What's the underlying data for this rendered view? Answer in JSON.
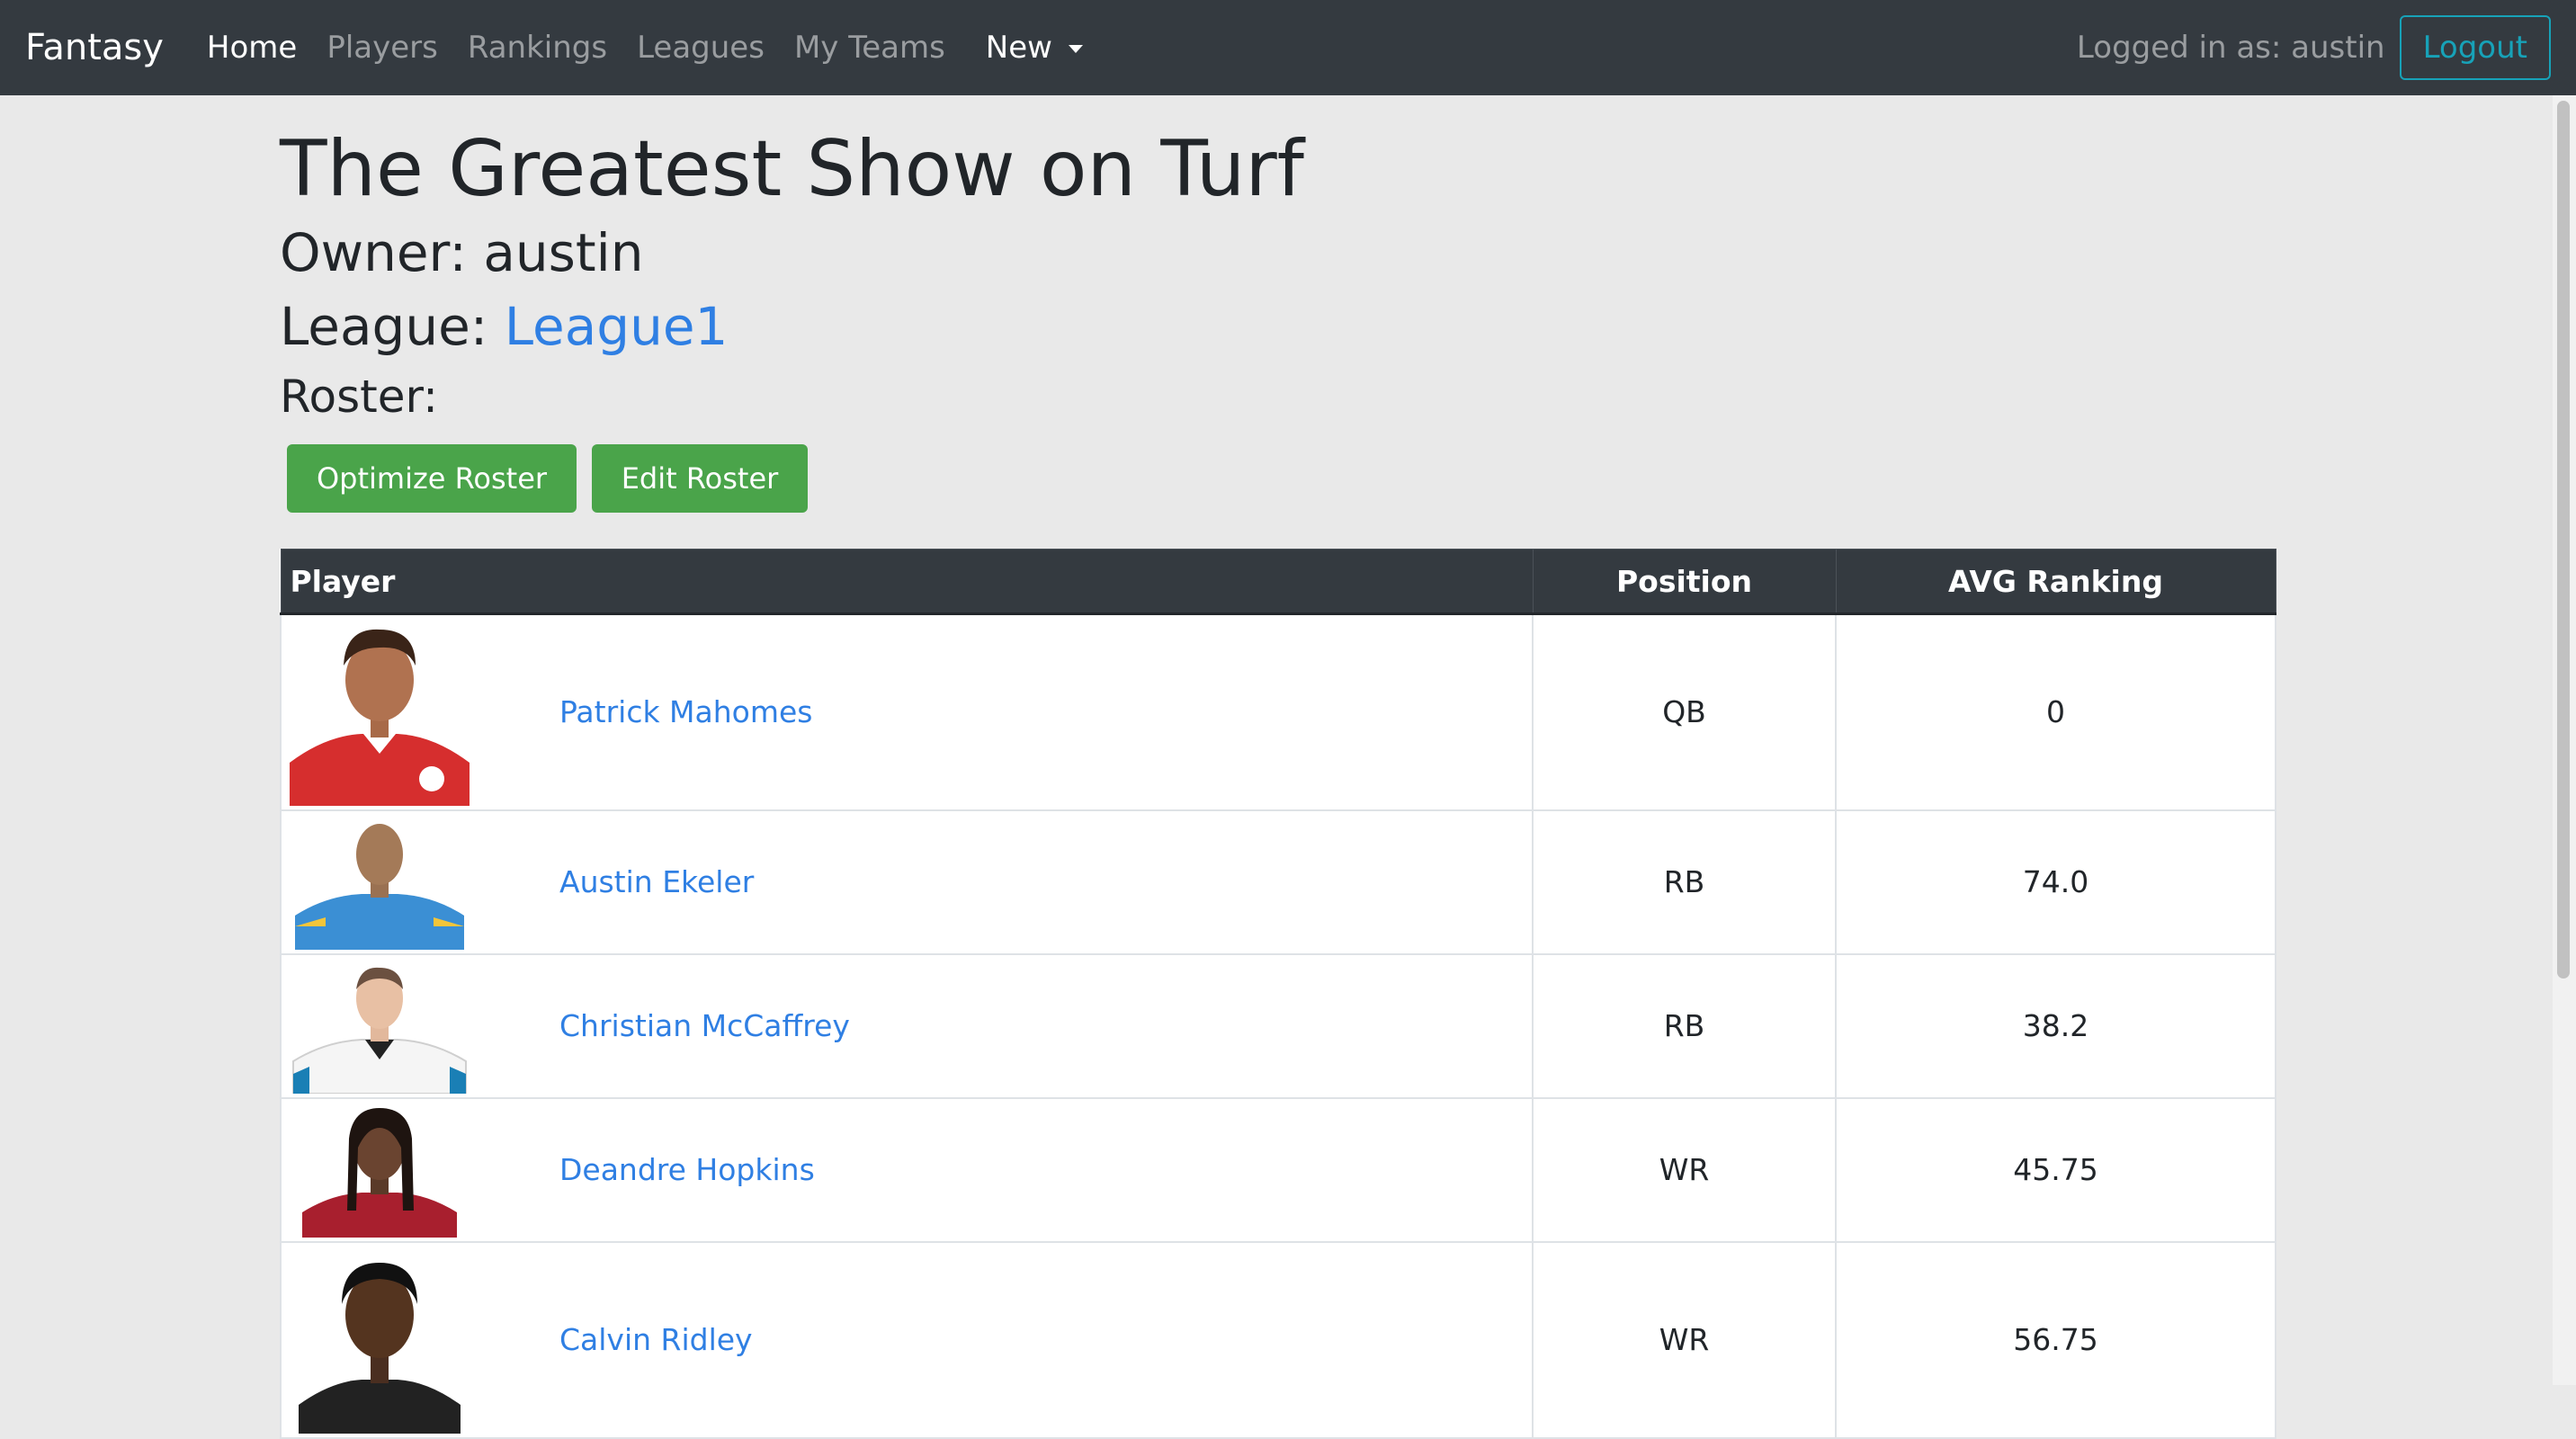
{
  "nav": {
    "brand": "Fantasy",
    "links": [
      "Home",
      "Players",
      "Rankings",
      "Leagues",
      "My Teams"
    ],
    "dropdown": "New",
    "logged_in": "Logged in as: austin",
    "logout": "Logout"
  },
  "team": {
    "title": "The Greatest Show on Turf",
    "owner_label": "Owner:",
    "owner": "austin",
    "league_label": "League:",
    "league": "League1",
    "roster_label": "Roster:"
  },
  "actions": {
    "optimize": "Optimize Roster",
    "edit": "Edit Roster"
  },
  "table": {
    "headers": [
      "Player",
      "Position",
      "AVG Ranking"
    ],
    "rows": [
      {
        "name": "Patrick Mahomes",
        "position": "QB",
        "rank": "0"
      },
      {
        "name": "Austin Ekeler",
        "position": "RB",
        "rank": "74.0"
      },
      {
        "name": "Christian McCaffrey",
        "position": "RB",
        "rank": "38.2"
      },
      {
        "name": "Deandre Hopkins",
        "position": "WR",
        "rank": "45.75"
      },
      {
        "name": "Calvin Ridley",
        "position": "WR",
        "rank": "56.75"
      }
    ]
  },
  "colors": {
    "navbar": "#343a40",
    "background": "#e9e9e9",
    "link": "#2f7fe3",
    "button": "#4aa44a",
    "logout": "#17a2b8",
    "jersey_colors": [
      "#d62e2e",
      "#3b8fd4",
      "#ffffff",
      "#a81f2e",
      "#222222"
    ]
  }
}
